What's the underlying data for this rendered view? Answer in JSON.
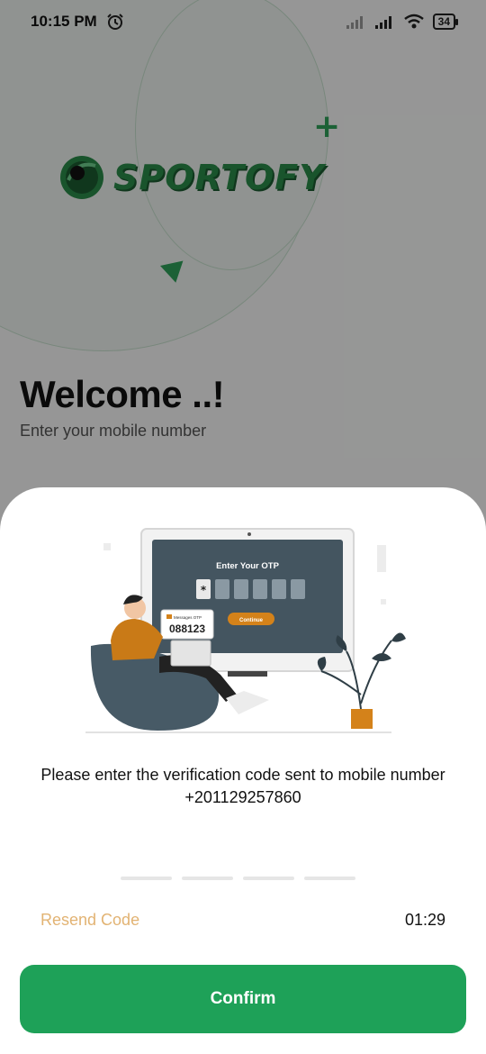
{
  "status_bar": {
    "time": "10:15 PM",
    "battery": "34"
  },
  "app": {
    "logo_text": "SPORTOFY",
    "welcome_title": "Welcome ..!",
    "subtitle": "Enter your mobile number"
  },
  "otp_sheet": {
    "illustration": {
      "screen_title": "Enter Your OTP",
      "screen_button": "Continue",
      "message_card_title": "Messages OTP",
      "message_card_code": "088123"
    },
    "message": "Please enter the verification code sent to mobile number +201129257860",
    "otp_slots": [
      "",
      "",
      "",
      ""
    ],
    "resend_label": "Resend Code",
    "timer": "01:29",
    "confirm_label": "Confirm"
  },
  "colors": {
    "brand_green": "#1ea158",
    "resend_color": "#e2b373"
  }
}
